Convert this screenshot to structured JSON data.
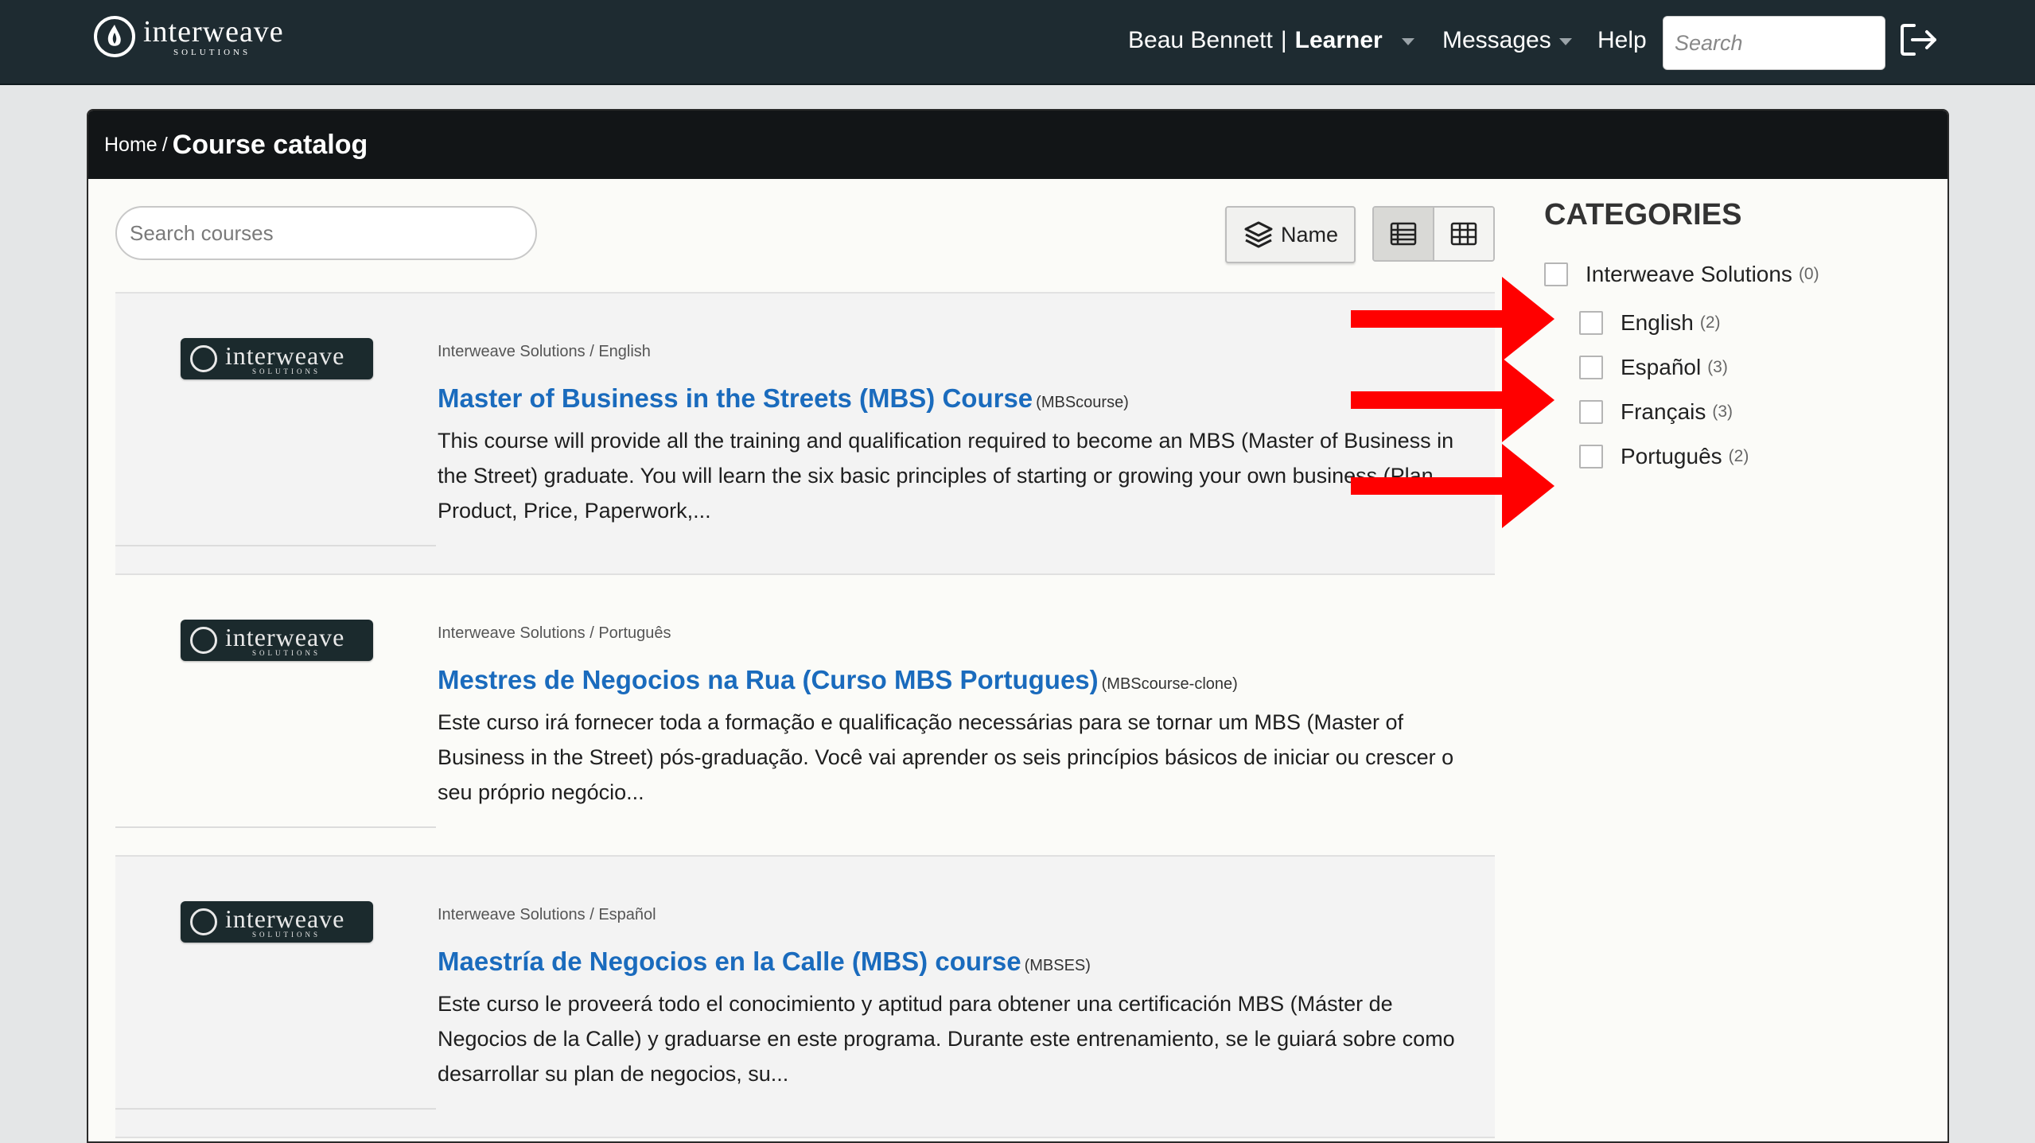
{
  "app": {
    "logo_word": "interweave",
    "logo_sub": "SOLUTIONS"
  },
  "topnav": {
    "user_name": "Beau Bennett",
    "separator": "|",
    "role": "Learner",
    "messages": "Messages",
    "help": "Help",
    "search_placeholder": "Search"
  },
  "breadcrumb": {
    "home": "Home",
    "separator": "/",
    "current": "Course catalog"
  },
  "toolbar": {
    "search_placeholder": "Search courses",
    "sort_label": "Name"
  },
  "courses": [
    {
      "category": "Interweave Solutions / English",
      "title": "Master of Business in the Streets (MBS) Course",
      "code": "(MBScourse)",
      "description": "This course will provide all the training and qualification required to become an MBS (Master of Business in the Street) graduate. You will learn the six basic principles of starting or growing your own business (Plan, Product, Price, Paperwork,..."
    },
    {
      "category": "Interweave Solutions / Português",
      "title": "Mestres de Negocios na Rua (Curso MBS Portugues)",
      "code": "(MBScourse-clone)",
      "description": "Este curso irá fornecer toda a formação e qualificação necessárias para se tornar um MBS (Master of Business in the Street) pós-graduação. Você vai aprender os seis princípios básicos de iniciar ou crescer o seu próprio negócio..."
    },
    {
      "category": "Interweave Solutions / Español",
      "title": "Maestría de Negocios en la Calle (MBS) course",
      "code": "(MBSES)",
      "description": "Este curso le proveerá todo el conocimiento y aptitud para obtener una certificación MBS (Máster de Negocios de la Calle) y graduarse en este programa. Durante este entrenamiento, se le guiará sobre como desarrollar su plan de negocios, su..."
    }
  ],
  "categories": {
    "heading": "CATEGORIES",
    "items": [
      {
        "label": "Interweave Solutions",
        "count": "(0)"
      },
      {
        "label": "English",
        "count": "(2)"
      },
      {
        "label": "Español",
        "count": "(3)"
      },
      {
        "label": "Français",
        "count": "(3)"
      },
      {
        "label": "Português",
        "count": "(2)"
      }
    ]
  },
  "colors": {
    "topbar": "#1e2b31",
    "link": "#1a6bbd",
    "annotation_arrow": "#ff0000"
  },
  "icons": [
    "logo-icon",
    "caret-down-icon",
    "logout-icon",
    "layers-icon",
    "list-view-icon",
    "grid-view-icon",
    "checkbox-icon",
    "arrow-annotation-icon"
  ]
}
